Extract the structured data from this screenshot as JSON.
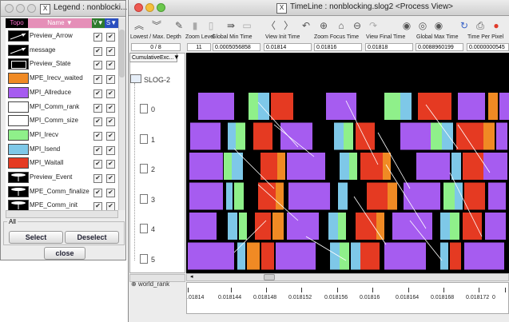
{
  "legend": {
    "title": "Legend : nonblocki...",
    "headers": {
      "topo": "Topo",
      "name": "Name ▼",
      "v": "V▼",
      "s": "S▼"
    },
    "items": [
      {
        "name": "Preview_Arrow",
        "color": "#000000"
      },
      {
        "name": "message",
        "color": "#000000"
      },
      {
        "name": "Preview_State",
        "color": "#ffffff"
      },
      {
        "name": "MPE_Irecv_waited",
        "color": "#f08a24"
      },
      {
        "name": "MPI_Allreduce",
        "color": "#a65cf0"
      },
      {
        "name": "MPI_Comm_rank",
        "color": "#ffffff"
      },
      {
        "name": "MPI_Comm_size",
        "color": "#ffffff"
      },
      {
        "name": "MPI_Irecv",
        "color": "#8ff08a"
      },
      {
        "name": "MPI_Isend",
        "color": "#7ec8e8"
      },
      {
        "name": "MPI_Waitall",
        "color": "#e53a22"
      },
      {
        "name": "Preview_Event",
        "color": "#ffffff"
      },
      {
        "name": "MPE_Comm_finalize",
        "color": "#ffffff"
      },
      {
        "name": "MPE_Comm_init",
        "color": "#ffffff"
      }
    ],
    "all_label": "All",
    "select_label": "Select",
    "deselect_label": "Deselect",
    "close_label": "close"
  },
  "timeline": {
    "title": "TimeLine : nonblocking.slog2  <Process View>",
    "columns": [
      {
        "label": "Lowest / Max. Depth",
        "value": "0 / 8"
      },
      {
        "label": "Zoom Level",
        "value": "11"
      },
      {
        "label": "Global Min Time",
        "value": "0.0005056858"
      },
      {
        "label": "View  Init Time",
        "value": "0.01814"
      },
      {
        "label": "Zoom Focus Time",
        "value": "0.01816"
      },
      {
        "label": "View Final Time",
        "value": "0.01818"
      },
      {
        "label": "Global Max Time",
        "value": "0.0088960199"
      },
      {
        "label": "Time Per Pixel",
        "value": "0.0000000545"
      }
    ],
    "dropdown": "CumulativeExc...",
    "tree_root": "SLOG-2",
    "rows": [
      "0",
      "1",
      "2",
      "3",
      "4",
      "5"
    ],
    "world_rank": "world_rank",
    "ticks": [
      ".01814",
      "0.018144",
      "0.018148",
      "0.018152",
      "0.018156",
      "0.01816",
      "0.018164",
      "0.018168",
      "0.018172",
      "0"
    ]
  }
}
